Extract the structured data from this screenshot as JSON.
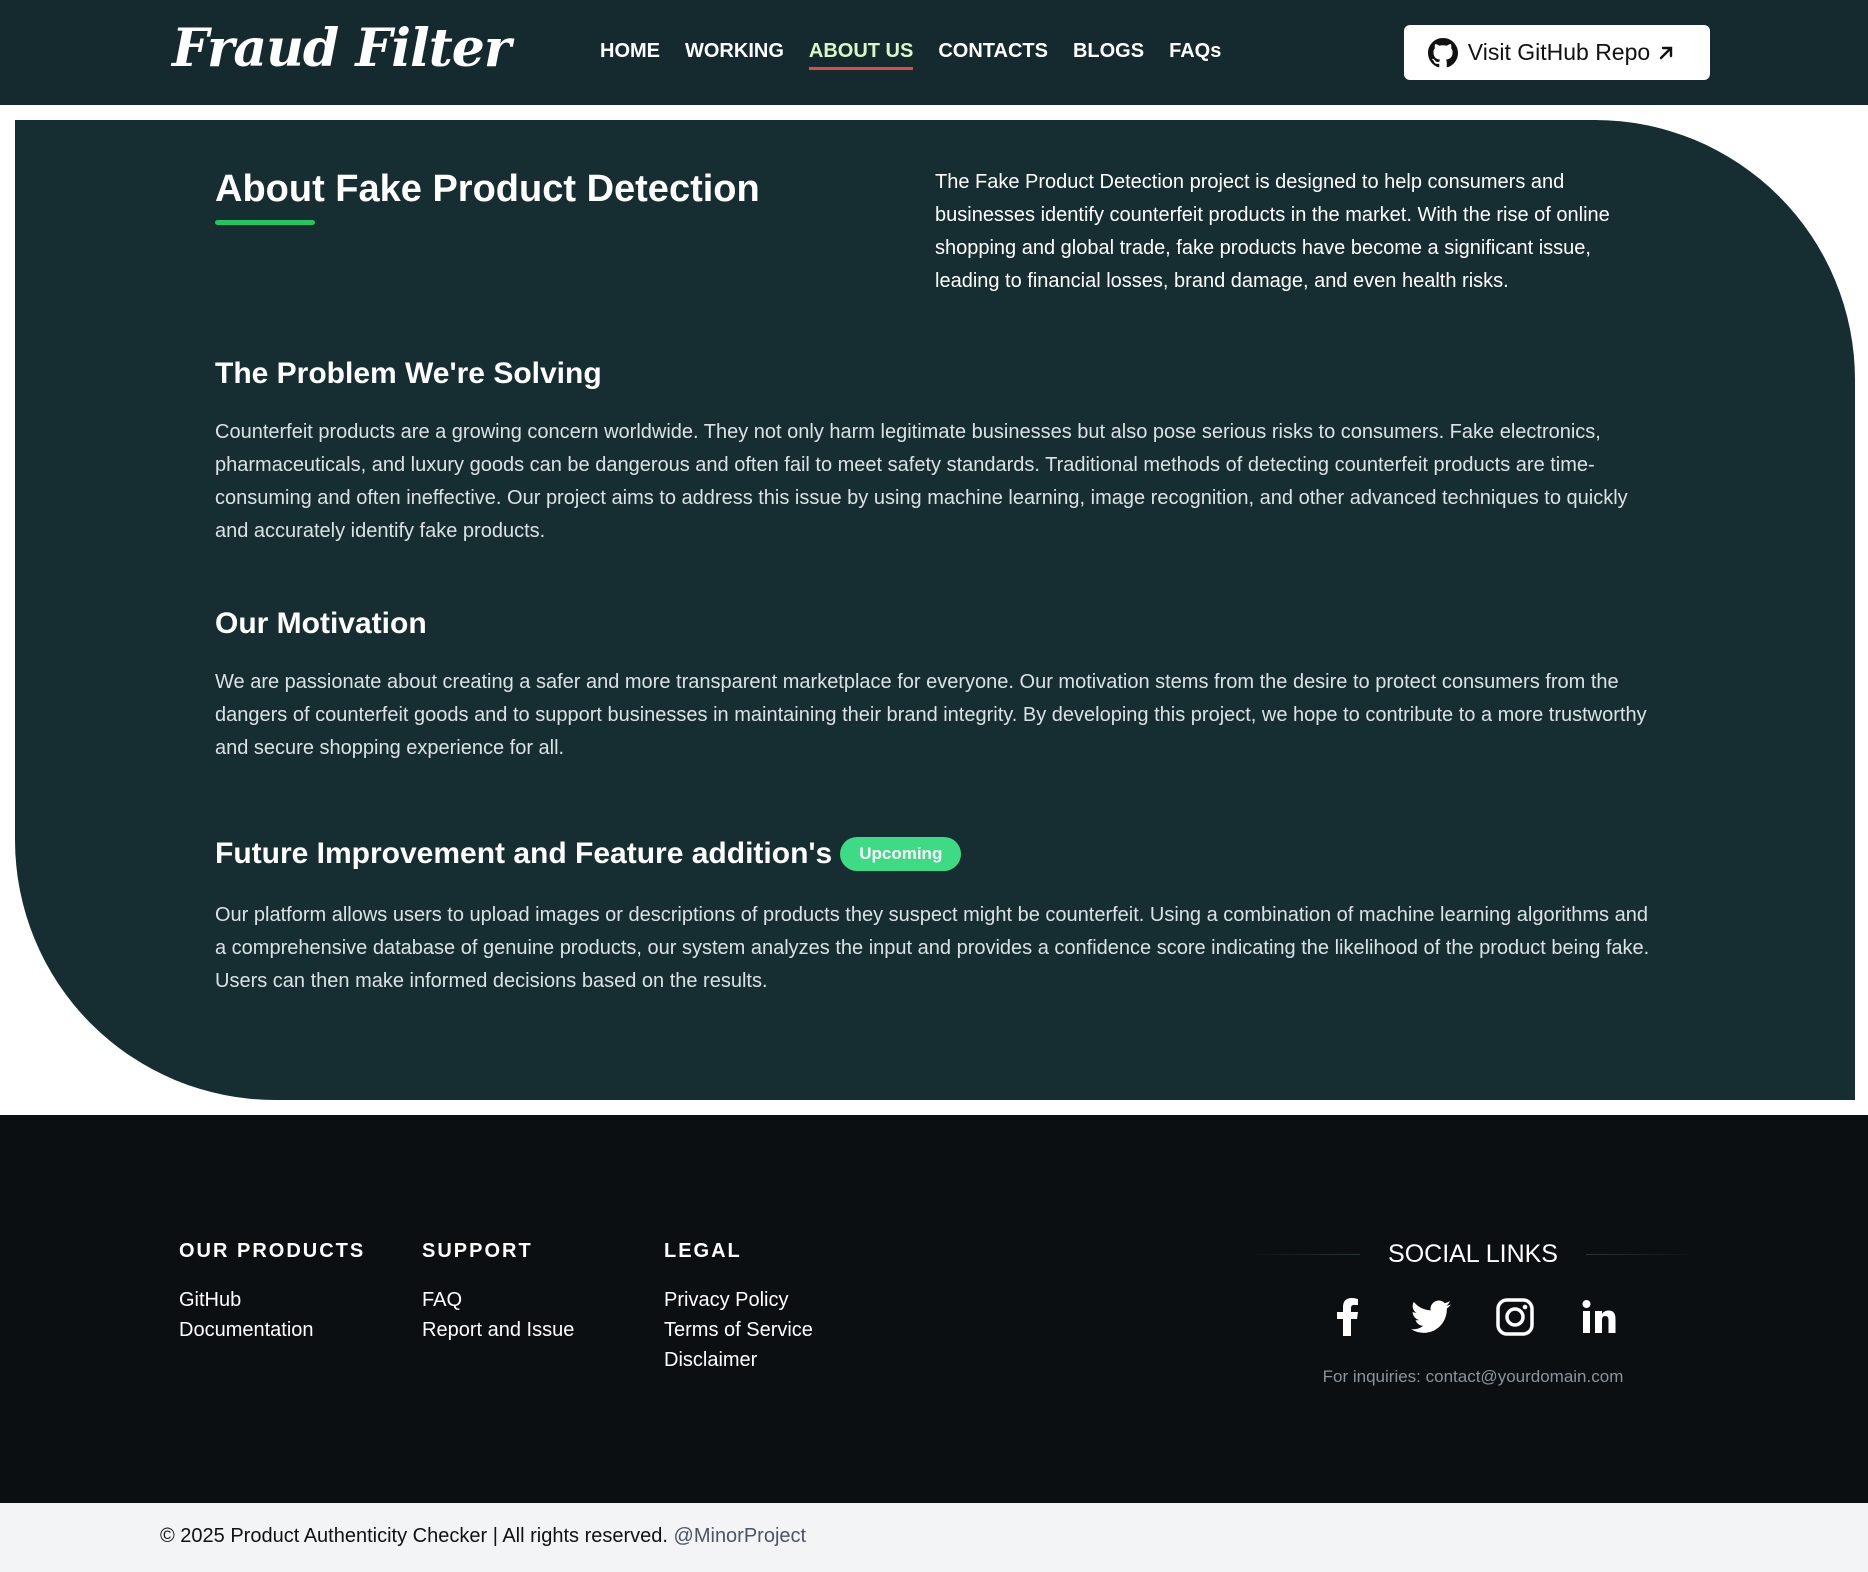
{
  "header": {
    "logo": "Fraud Filter",
    "nav": [
      "HOME",
      "WORKING",
      "ABOUT US",
      "CONTACTS",
      "BLOGS",
      "FAQs"
    ],
    "active_nav": "ABOUT US",
    "github_button": "Visit GitHub Repo",
    "accent_color": "#22c55e",
    "active_underline_color": "#e24a4a"
  },
  "about": {
    "title": "About Fake Product Detection",
    "intro": "The Fake Product Detection project is designed to help consumers and businesses identify counterfeit products in the market. With the rise of online shopping and global trade, fake products have become a significant issue, leading to financial losses, brand damage, and even health risks.",
    "sections": [
      {
        "title": "The Problem We're Solving",
        "text": "Counterfeit products are a growing concern worldwide. They not only harm legitimate businesses but also pose serious risks to consumers. Fake electronics, pharmaceuticals, and luxury goods can be dangerous and often fail to meet safety standards. Traditional methods of detecting counterfeit products are time-consuming and often ineffective. Our project aims to address this issue by using machine learning, image recognition, and other advanced techniques to quickly and accurately identify fake products."
      },
      {
        "title": "Our Motivation",
        "text": "We are passionate about creating a safer and more transparent marketplace for everyone. Our motivation stems from the desire to protect consumers from the dangers of counterfeit goods and to support businesses in maintaining their brand integrity. By developing this project, we hope to contribute to a more trustworthy and secure shopping experience for all."
      },
      {
        "title": "Future Improvement and Feature addition's",
        "badge": "Upcoming",
        "text": "Our platform allows users to upload images or descriptions of products they suspect might be counterfeit. Using a combination of machine learning algorithms and a comprehensive database of genuine products, our system analyzes the input and provides a confidence score indicating the likelihood of the product being fake. Users can then make informed decisions based on the results."
      }
    ]
  },
  "footer": {
    "columns": [
      {
        "heading": "OUR PRODUCTS",
        "links": [
          "GitHub",
          "Documentation"
        ]
      },
      {
        "heading": "SUPPORT",
        "links": [
          "FAQ",
          "Report and Issue"
        ]
      },
      {
        "heading": "LEGAL",
        "links": [
          "Privacy Policy",
          "Terms of Service",
          "Disclaimer"
        ]
      }
    ],
    "social_title": "SOCIAL LINKS",
    "social_icons": [
      "facebook-icon",
      "twitter-icon",
      "instagram-icon",
      "linkedin-icon"
    ],
    "inquiries": "For inquiries: contact@yourdomain.com"
  },
  "bottom_bar": {
    "copyright": "© 2025 Product Authenticity Checker | All rights reserved.",
    "handle": "@MinorProject"
  }
}
